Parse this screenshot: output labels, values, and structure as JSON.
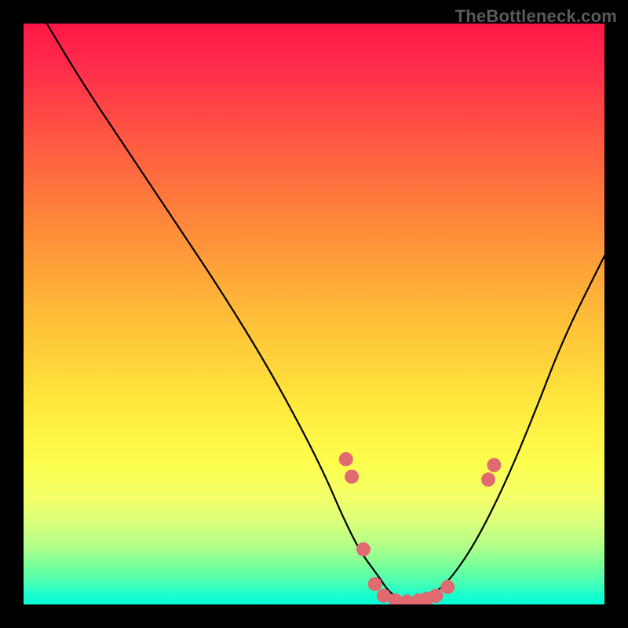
{
  "watermark": "TheBottleneck.com",
  "chart_data": {
    "type": "line",
    "title": "",
    "xlabel": "",
    "ylabel": "",
    "xlim": [
      0,
      100
    ],
    "ylim": [
      0,
      100
    ],
    "grid": false,
    "legend": false,
    "series": [
      {
        "name": "bottleneck-curve",
        "color": "#000000",
        "x": [
          4,
          10,
          18,
          26,
          34,
          42,
          48,
          52,
          55,
          58,
          61,
          63,
          65,
          68,
          71,
          74,
          78,
          83,
          88,
          93,
          100
        ],
        "y": [
          100,
          90,
          78,
          66,
          54,
          41,
          30,
          22,
          15,
          9,
          5,
          2,
          1,
          1,
          2,
          5,
          11,
          21,
          33,
          46,
          60
        ]
      }
    ],
    "markers": [
      {
        "name": "highlight-points",
        "color": "#e06a70",
        "radius": 9,
        "points": [
          {
            "x": 55.5,
            "y": 25.0
          },
          {
            "x": 56.5,
            "y": 22.0
          },
          {
            "x": 58.5,
            "y": 9.5
          },
          {
            "x": 60.5,
            "y": 3.5
          },
          {
            "x": 62.0,
            "y": 1.5
          },
          {
            "x": 64.0,
            "y": 0.7
          },
          {
            "x": 66.0,
            "y": 0.5
          },
          {
            "x": 68.0,
            "y": 0.7
          },
          {
            "x": 69.5,
            "y": 1.0
          },
          {
            "x": 71.0,
            "y": 1.5
          },
          {
            "x": 73.0,
            "y": 3.0
          },
          {
            "x": 80.0,
            "y": 21.5
          },
          {
            "x": 81.0,
            "y": 24.0
          }
        ]
      }
    ],
    "background_gradient": {
      "type": "vertical",
      "stops": [
        {
          "pos": 0.0,
          "color": "#ff1748"
        },
        {
          "pos": 0.35,
          "color": "#ff8a3a"
        },
        {
          "pos": 0.66,
          "color": "#ffe93d"
        },
        {
          "pos": 0.9,
          "color": "#b0ff88"
        },
        {
          "pos": 1.0,
          "color": "#00ffd8"
        }
      ]
    }
  }
}
